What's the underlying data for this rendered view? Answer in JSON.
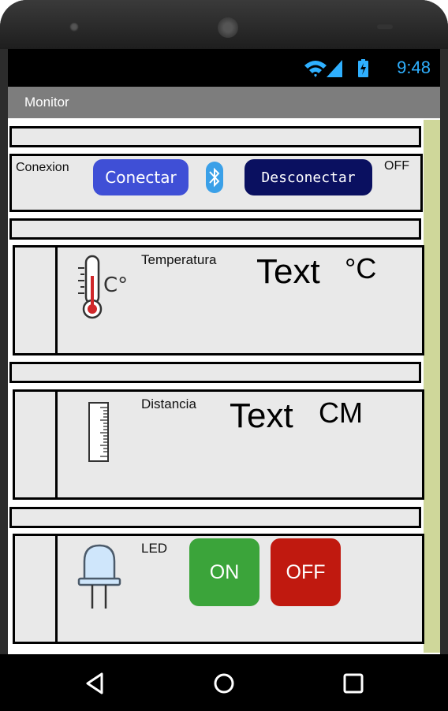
{
  "status_bar": {
    "time": "9:48"
  },
  "app": {
    "title": "Monitor"
  },
  "connection": {
    "label": "Conexion",
    "connect_label": "Conectar",
    "disconnect_label": "Desconectar",
    "state": "OFF"
  },
  "temperature": {
    "label": "Temperatura",
    "icon_text": "C°",
    "value": "Text",
    "unit": "°C"
  },
  "distance": {
    "label": "Distancia",
    "value": "Text",
    "unit": "CM"
  },
  "led": {
    "label": "LED",
    "on_label": "ON",
    "off_label": "OFF"
  },
  "colors": {
    "connect_button": "#3f4fd6",
    "disconnect_button": "#0a1060",
    "bluetooth": "#3aa0e8",
    "on_button": "#3ba43a",
    "off_button": "#c0190f",
    "title_bar": "#7d7d7d",
    "scrollbar": "#cfd79a",
    "status_accent": "#2fb0ff"
  },
  "icons": {
    "wifi": "wifi-icon",
    "signal": "signal-icon",
    "battery": "battery-icon",
    "bluetooth": "bluetooth-icon",
    "thermometer": "thermometer-icon",
    "ruler": "ruler-icon",
    "led": "led-bulb-icon",
    "back": "back-icon",
    "home": "home-icon",
    "recents": "recents-icon"
  }
}
